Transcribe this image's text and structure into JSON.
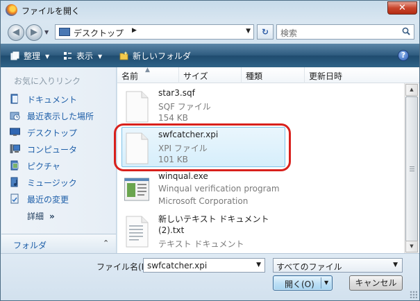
{
  "window": {
    "title": "ファイルを開く",
    "close_label": "✕"
  },
  "address": {
    "location": "デスクトップ",
    "search_placeholder": "検索"
  },
  "toolbar": {
    "organize_label": "整理",
    "view_label": "表示",
    "new_folder_label": "新しいフォルダ",
    "help_label": "?"
  },
  "nav": {
    "favorites_heading": "お気に入りリンク",
    "items": [
      {
        "label": "ドキュメント",
        "icon": "documents-icon"
      },
      {
        "label": "最近表示した場所",
        "icon": "recent-places-icon"
      },
      {
        "label": "デスクトップ",
        "icon": "desktop-icon"
      },
      {
        "label": "コンピュータ",
        "icon": "computer-icon"
      },
      {
        "label": "ピクチャ",
        "icon": "pictures-icon"
      },
      {
        "label": "ミュージック",
        "icon": "music-icon"
      },
      {
        "label": "最近の変更",
        "icon": "recently-changed-icon"
      }
    ],
    "details_label": "詳細",
    "details_chevron": "»",
    "folder_label": "フォルダ",
    "folder_chevron": "⌃"
  },
  "columns": [
    "名前",
    "サイズ",
    "種類",
    "更新日時"
  ],
  "files": [
    {
      "name": "star3.sqf",
      "line2": "SQF ファイル",
      "line3": "154 KB",
      "icon": "document-icon",
      "selected": false
    },
    {
      "name": "swfcatcher.xpi",
      "line2": "XPI ファイル",
      "line3": "101 KB",
      "icon": "document-icon",
      "selected": true
    },
    {
      "name": "winqual.exe",
      "line2": "Winqual verification program",
      "line3": "Microsoft Corporation",
      "icon": "application-icon",
      "selected": false
    },
    {
      "name": "新しいテキスト ドキュメント",
      "line2": "(2).txt",
      "line3": "テキスト ドキュメント",
      "icon": "text-file-icon",
      "selected": false
    }
  ],
  "bottom": {
    "filename_label": "ファイル名(N):",
    "filename_value": "swfcatcher.xpi",
    "filetype_value": "すべてのファイル",
    "open_label": "開く(O)",
    "cancel_label": "キャンセル"
  },
  "colors": {
    "accent": "#1d5ea8",
    "selection": "#d6eefb",
    "annotation": "#d8201c",
    "command_bar": "#2d5a7e"
  }
}
